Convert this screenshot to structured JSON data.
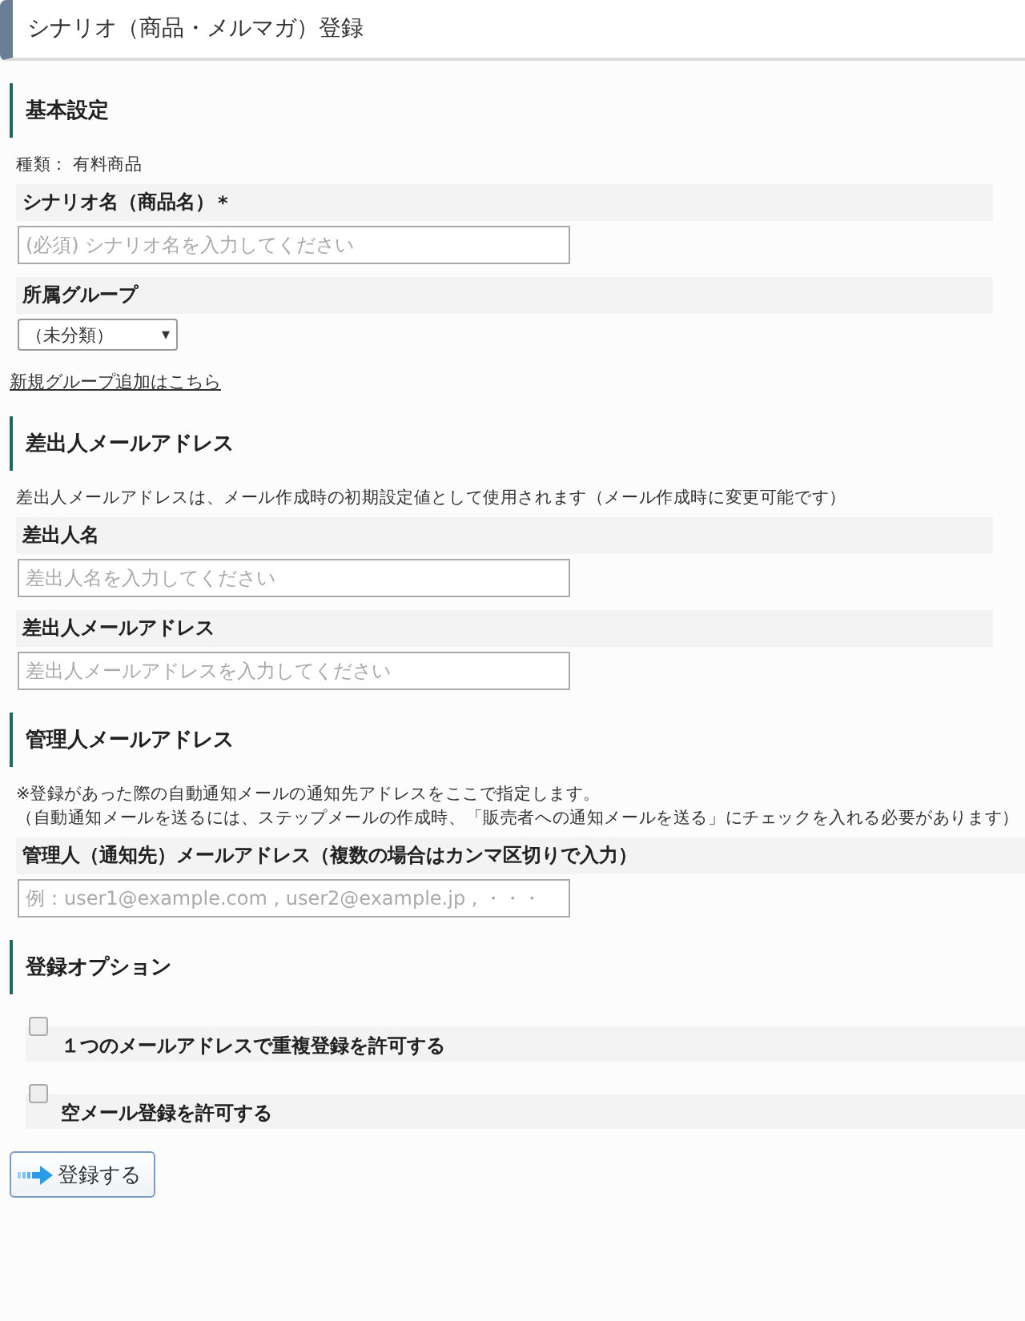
{
  "page_title": "シナリオ（商品・メルマガ）登録",
  "sections": [
    {
      "heading": "基本設定",
      "items": [
        {
          "kind": "note",
          "lines": [
            "種類： 有料商品"
          ]
        },
        {
          "kind": "text_field",
          "label": "シナリオ名（商品名）",
          "required_mark": "*",
          "placeholder": "(必須) シナリオ名を入力してください"
        },
        {
          "kind": "select",
          "label": "所属グループ",
          "value": "（未分類）",
          "arrow": "▾"
        },
        {
          "kind": "link",
          "text": "新規グループ追加はこちら"
        }
      ]
    },
    {
      "heading": "差出人メールアドレス",
      "items": [
        {
          "kind": "note",
          "lines": [
            "差出人メールアドレスは、メール作成時の初期設定値として使用されます（メール作成時に変更可能です）"
          ]
        },
        {
          "kind": "text_field",
          "label": "差出人名",
          "placeholder": "差出人名を入力してください"
        },
        {
          "kind": "text_field",
          "label": "差出人メールアドレス",
          "placeholder": "差出人メールアドレスを入力してください"
        }
      ]
    },
    {
      "heading": "管理人メールアドレス",
      "items": [
        {
          "kind": "note",
          "lines": [
            "※登録があった際の自動通知メールの通知先アドレスをここで指定します。",
            "（自動通知メールを送るには、ステップメールの作成時、「販売者への通知メールを送る」にチェックを入れる必要があります）"
          ]
        },
        {
          "kind": "text_field",
          "label": "管理人（通知先）メールアドレス（複数の場合はカンマ区切りで入力）",
          "placeholder": "例：user1@example.com , user2@example.jp , ・・・"
        }
      ]
    },
    {
      "heading": "登録オプション",
      "items": [
        {
          "kind": "checkbox",
          "label": "１つのメールアドレスで重複登録を許可する",
          "checked": false
        },
        {
          "kind": "checkbox",
          "label": "空メール登録を許可する",
          "checked": false
        }
      ]
    }
  ],
  "submit_button": "登録する"
}
